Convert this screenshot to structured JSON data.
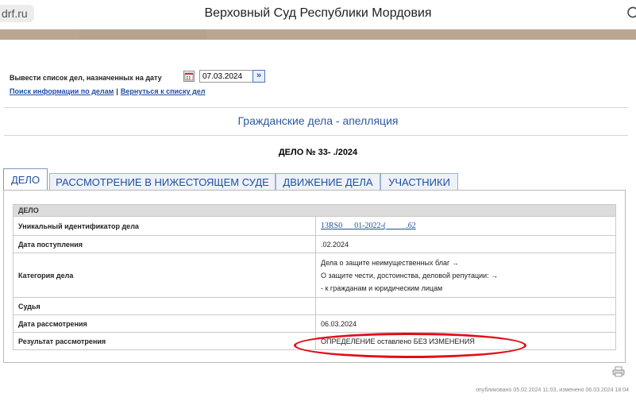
{
  "browser": {
    "url_fragment": "drf.ru",
    "page_title": "Верховный Суд Республики Мордовия"
  },
  "search_row": {
    "label": "Вывести список дел, назначенных на дату",
    "date_value": "07.03.2024",
    "go_glyph": "»"
  },
  "links": {
    "search": "Поиск информации по делам",
    "separator": "|",
    "back": "Вернуться к списку дел"
  },
  "section_title": "Гражданские дела - апелляция",
  "case_number": "ДЕЛО № 33-     ./2024",
  "tabs": [
    {
      "label": "ДЕЛО",
      "active": true
    },
    {
      "label": "РАССМОТРЕНИЕ В НИЖЕСТОЯЩЕМ СУДЕ",
      "active": false
    },
    {
      "label": "ДВИЖЕНИЕ ДЕЛА",
      "active": false
    },
    {
      "label": "УЧАСТНИКИ",
      "active": false
    }
  ],
  "table": {
    "header": "ДЕЛО",
    "rows": [
      {
        "key": "Уникальный идентификатор дела",
        "value": "13RS0___01-2022-(_____.62"
      },
      {
        "key": "Дата поступления",
        "value": "   .02.2024"
      },
      {
        "key": "Категория дела",
        "value_lines": [
          "Дела о защите неимущественных благ →",
          "О защите чести, достоинства, деловой репутации: →",
          "- к гражданам и юридическим лицам"
        ]
      },
      {
        "key": "Судья",
        "value": ""
      },
      {
        "key": "Дата рассмотрения",
        "value": "06.03.2024"
      },
      {
        "key": "Результат рассмотрения",
        "value": "ОПРЕДЕЛЕНИЕ оставлено БЕЗ ИЗМЕНЕНИЯ"
      }
    ]
  },
  "footer": "опубликовано 05.02.2024 11:03, изменено 06.03.2024 18:04",
  "annotation_color": "#e20d17",
  "icons": {
    "calendar": "calendar-icon",
    "print": "print-icon",
    "reload": "reload-icon"
  }
}
